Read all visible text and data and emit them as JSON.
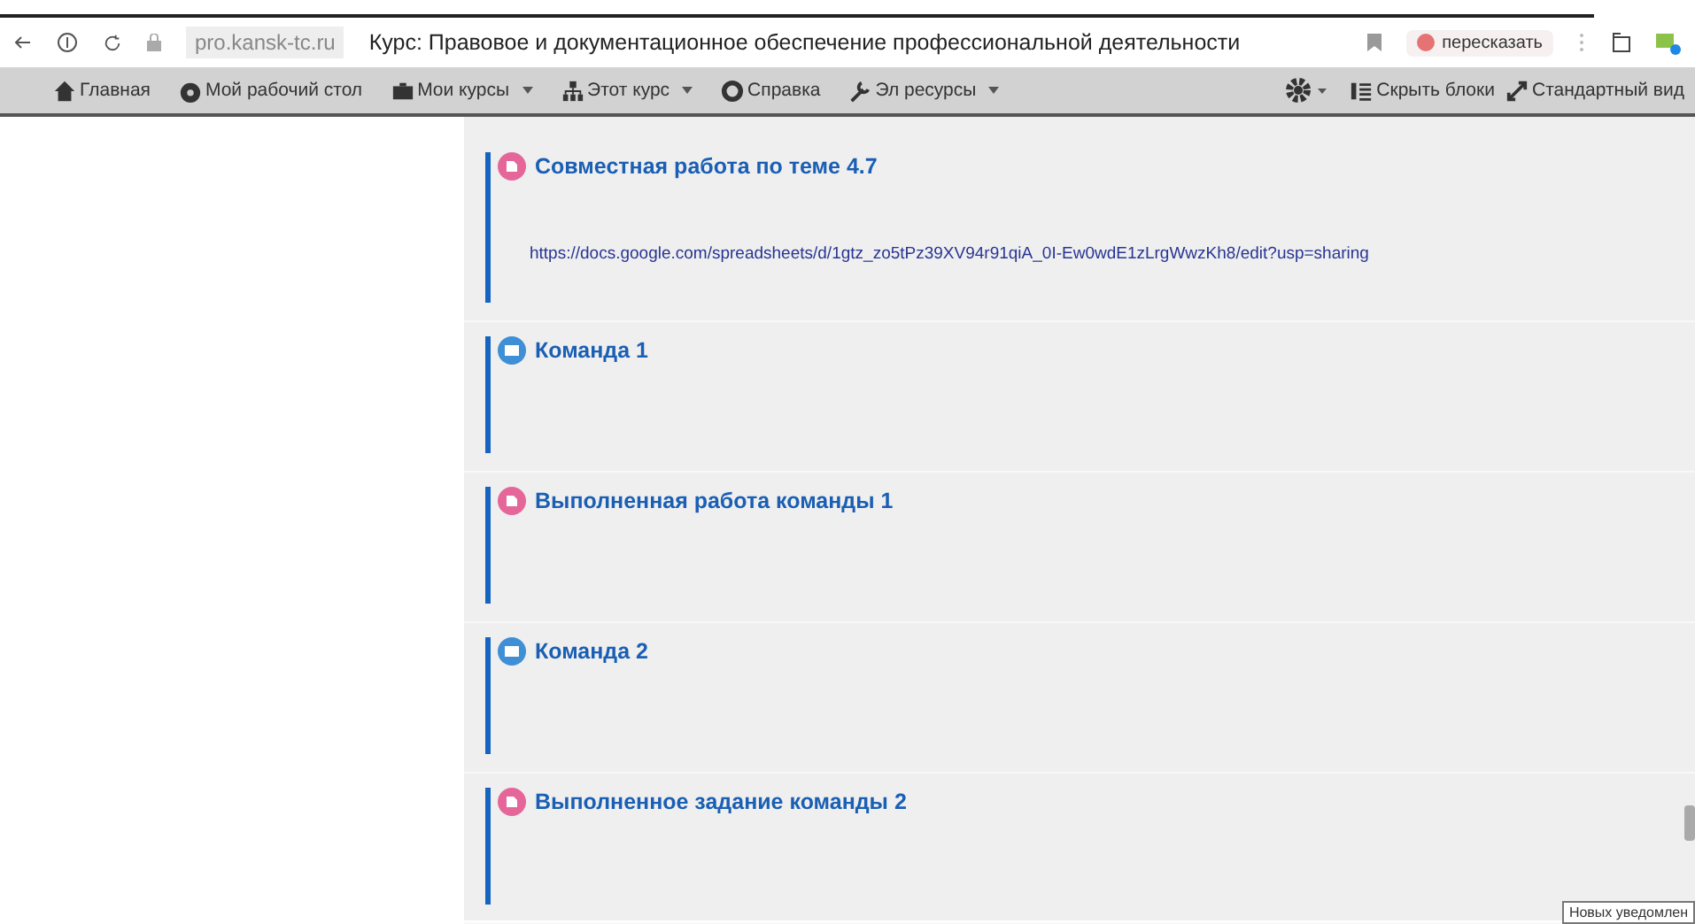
{
  "browser": {
    "url": "pro.kansk-tc.ru",
    "title": "Курс: Правовое и документационное обеспечение профессиональной деятельности",
    "extension_label": "пересказать"
  },
  "navbar": {
    "items": [
      {
        "label": "Главная",
        "dropdown": false
      },
      {
        "label": "Мой рабочий стол",
        "dropdown": false
      },
      {
        "label": "Мои курсы",
        "dropdown": true
      },
      {
        "label": "Этот курс",
        "dropdown": true
      },
      {
        "label": "Справка",
        "dropdown": false
      },
      {
        "label": "Эл ресурсы",
        "dropdown": true
      }
    ],
    "right_items": [
      {
        "label": "Скрыть блоки"
      },
      {
        "label": "Стандартный вид"
      }
    ]
  },
  "activities": [
    {
      "kind": "assignment",
      "title": "Совместная работа по теме 4.7",
      "link": "https://docs.google.com/spreadsheets/d/1gtz_zo5tPz39XV94r91qiA_0I-Ew0wdE1zLrgWwzKh8/edit?usp=sharing"
    },
    {
      "kind": "folder",
      "title": "Команда 1"
    },
    {
      "kind": "assignment",
      "title": "Выполненная работа команды 1"
    },
    {
      "kind": "folder",
      "title": "Команда 2"
    },
    {
      "kind": "assignment",
      "title": "Выполненное задание команды 2"
    }
  ],
  "tooltip": "Новых уведомлен"
}
